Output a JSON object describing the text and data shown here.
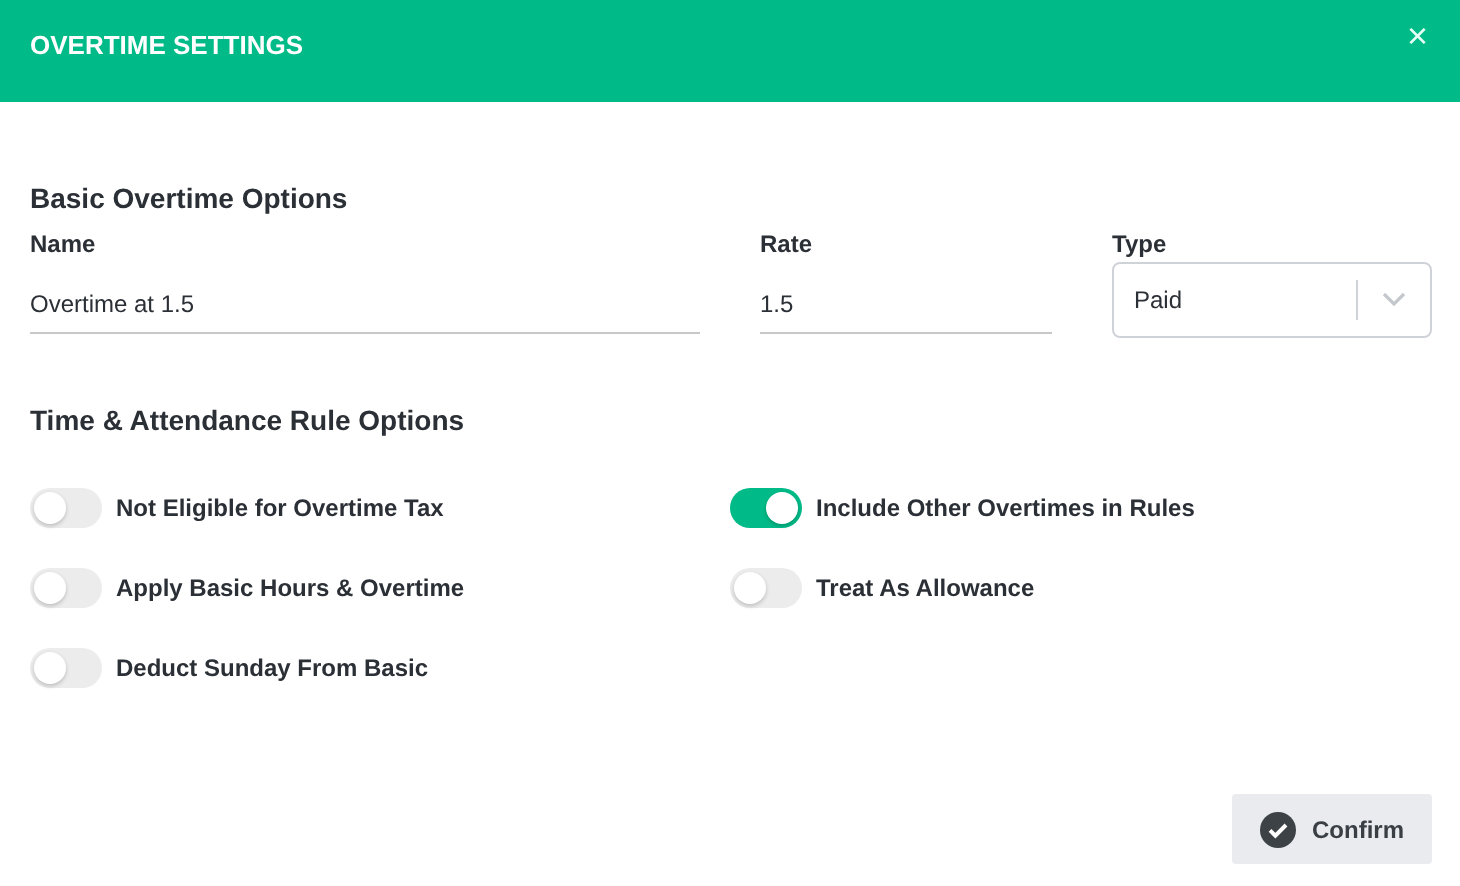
{
  "window": {
    "title": "OVERTIME SETTINGS",
    "close": "×"
  },
  "basic": {
    "heading": "Basic Overtime Options",
    "fields": [
      {
        "label": "Name",
        "value": "Overtime at 1.5",
        "kind": "text"
      },
      {
        "label": "Rate",
        "value": "1.5",
        "kind": "text"
      },
      {
        "label": "Type",
        "value": "Paid",
        "kind": "select"
      }
    ]
  },
  "rules": {
    "heading": "Time & Attendance Rule Options",
    "options": [
      {
        "label": "Not Eligible for Overtime Tax",
        "on": false
      },
      {
        "label": "Include Other Overtimes in Rules",
        "on": true
      },
      {
        "label": "Apply Basic Hours & Overtime",
        "on": false
      },
      {
        "label": "Treat As Allowance",
        "on": false
      },
      {
        "label": "Deduct Sunday From Basic",
        "on": false
      }
    ]
  },
  "buttons": [
    {
      "label": "Confirm"
    }
  ]
}
